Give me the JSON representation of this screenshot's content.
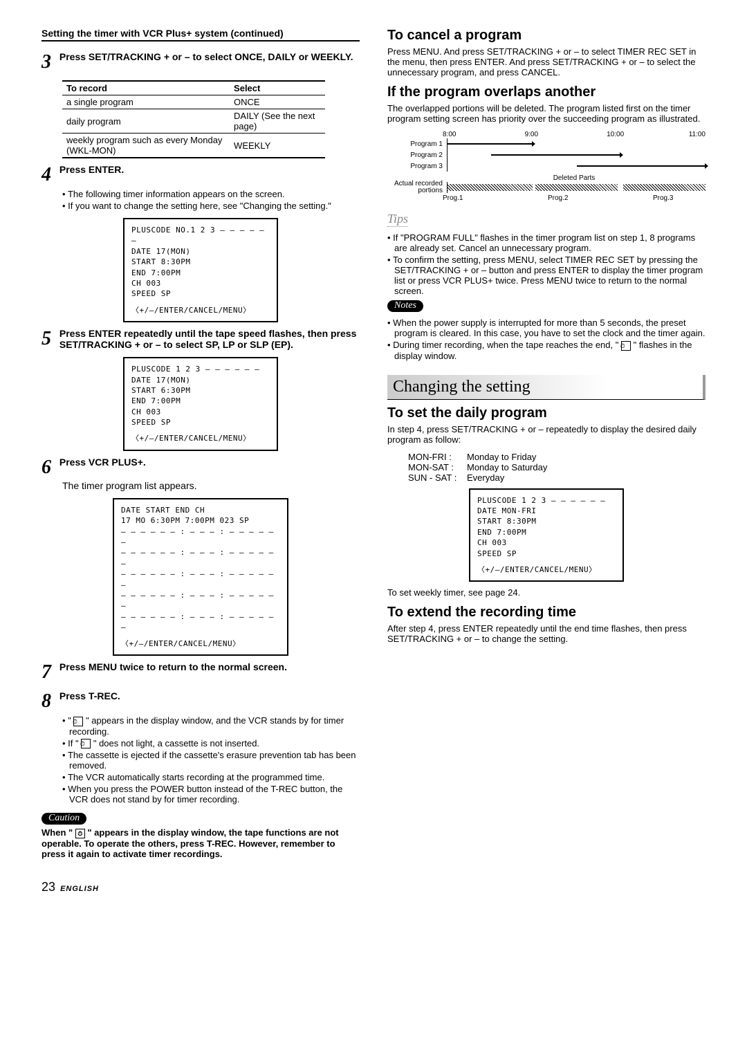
{
  "left": {
    "continued": "Setting the timer with VCR Plus+ system (continued)",
    "step3": {
      "num": "3",
      "text": "Press SET/TRACKING + or – to select ONCE, DAILY or WEEKLY."
    },
    "table": {
      "h1": "To record",
      "h2": "Select",
      "r1a": "a single program",
      "r1b": "ONCE",
      "r2a": "daily program",
      "r2b": "DAILY (See the next page)",
      "r3a": "weekly program such as every Monday (WKL-MON)",
      "r3b": "WEEKLY"
    },
    "step4": {
      "num": "4",
      "text": "Press ENTER.",
      "b1": "The following timer information appears on the screen.",
      "b2": "If you want to change the setting here, see \"Changing the setting.\""
    },
    "osd1": {
      "l1": "PLUSCODE NO.1 2 3 – – – – – –",
      "l2": "DATE      17(MON)",
      "l3": "START     8:30PM",
      "l4": "END       7:00PM",
      "l5": "CH        003",
      "l6": "SPEED     SP",
      "foot": "〈+/–/ENTER/CANCEL/MENU〉"
    },
    "step5": {
      "num": "5",
      "text": "Press ENTER repeatedly until the tape speed flashes, then press SET/TRACKING + or – to select SP, LP or SLP (EP)."
    },
    "osd2": {
      "l1": "PLUSCODE 1 2 3 – – – – – –",
      "l2": "DATE      17(MON)",
      "l3": "START     6:30PM",
      "l4": "END       7:00PM",
      "l5": "CH        003",
      "l6": "SPEED     SP",
      "foot": "〈+/–/ENTER/CANCEL/MENU〉"
    },
    "step6": {
      "num": "6",
      "text": "Press VCR PLUS+.",
      "body": "The timer program list appears."
    },
    "osd3": {
      "l1": "DATE   START  END    CH",
      "l2": "17 MO  6:30PM 7:00PM 023 SP",
      "dash": "– – – – –  – : – –  – : – –  – – –  –",
      "foot": "〈+/–/ENTER/CANCEL/MENU〉"
    },
    "step7": {
      "num": "7",
      "text": "Press MENU twice to return to the normal screen."
    },
    "step8": {
      "num": "8",
      "text": "Press T-REC.",
      "b1a": "\" ",
      "b1b": " \" appears in the display window, and the VCR stands by for timer recording.",
      "b2a": "If \" ",
      "b2b": " \" does not light, a cassette is not inserted.",
      "b3": "The cassette is ejected if the cassette's erasure prevention tab has been removed.",
      "b4": "The VCR automatically starts recording at the programmed time.",
      "b5": "When you press the POWER button instead of the T-REC button, the VCR does not stand by for timer recording."
    },
    "caution_label": "Caution",
    "caution_a": "When \" ",
    "caution_b": " \" appears in the display window, the  tape functions are not operable. To operate the others, press T-REC.  However, remember to press it again to activate timer recordings."
  },
  "right": {
    "cancel_h": "To cancel a program",
    "cancel_p": "Press MENU. And press SET/TRACKING + or – to select TIMER REC SET in the menu, then press ENTER. And press SET/TRACKING + or – to select the unnecessary program, and press CANCEL.",
    "overlap_h": "If the program overlaps another",
    "overlap_p": "The overlapped portions will be deleted. The program listed first on the timer program setting screen has priority over the succeeding program as illustrated.",
    "timeline": {
      "t1": "8:00",
      "t2": "9:00",
      "t3": "10:00",
      "t4": "11:00",
      "p1": "Program 1",
      "p2": "Program 2",
      "p3": "Program 3",
      "act": "Actual recorded portions",
      "del": "Deleted Parts",
      "pg1": "Prog.1",
      "pg2": "Prog.2",
      "pg3": "Prog.3"
    },
    "tips_label": "Tips",
    "tip1": "If \"PROGRAM FULL\" flashes in the timer program list on step 1, 8 programs are already set. Cancel an unnecessary program.",
    "tip2": "To confirm the setting, press MENU, select TIMER REC SET by pressing the SET/TRACKING + or – button and press ENTER to display the timer program list or press VCR PLUS+ twice. Press MENU twice to return to the normal screen.",
    "notes_label": "Notes",
    "note1": "When the power supply is interrupted for more than 5 seconds, the preset program is cleared. In this case, you have to set the clock and the timer again.",
    "note2a": "During timer recording, when the tape reaches the end, \" ",
    "note2b": " \" flashes in the display window.",
    "changing": "Changing the setting",
    "daily_h": "To set the daily program",
    "daily_p": "In step 4, press SET/TRACKING + or – repeatedly to display the desired daily program as follow:",
    "d1k": "MON-FRI :",
    "d1v": "Monday to Friday",
    "d2k": "MON-SAT :",
    "d2v": "Monday to Saturday",
    "d3k": "SUN - SAT :",
    "d3v": "Everyday",
    "osd4": {
      "l1": "PLUSCODE 1 2 3 – – – – – –",
      "l2": "DATE      MON-FRI",
      "l3": "START     8:30PM",
      "l4": "END       7:00PM",
      "l5": "CH        003",
      "l6": "SPEED     SP",
      "foot": "〈+/–/ENTER/CANCEL/MENU〉"
    },
    "weekly": "To set weekly timer, see page 24.",
    "extend_h": "To extend the recording time",
    "extend_p": "After step 4, press ENTER repeatedly until the end time flashes, then press SET/TRACKING + or – to change the setting."
  },
  "footer": {
    "page": "23",
    "lang": "ENGLISH"
  }
}
